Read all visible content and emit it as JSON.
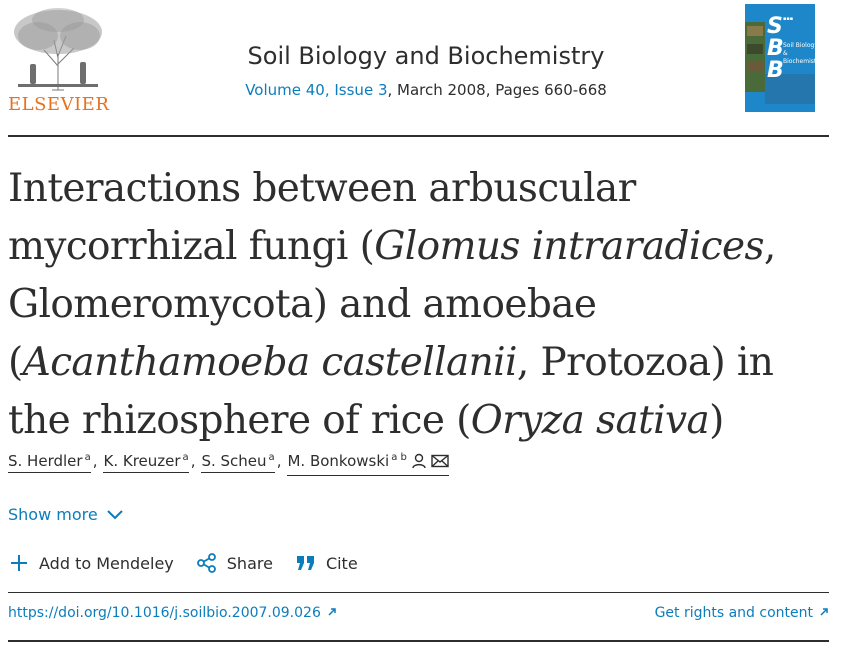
{
  "publisher": {
    "name": "ELSEVIER"
  },
  "journal": {
    "title": "Soil Biology and Biochemistry",
    "volume_issue": "Volume 40, Issue 3",
    "date_pages": ", March 2008, Pages 660-668"
  },
  "cover": {
    "letters": [
      "S",
      "B",
      "B"
    ],
    "title_line1": "Soil Biology &",
    "title_line2": "Biochemistry"
  },
  "article": {
    "title_parts": {
      "p1": "Interactions between arbuscular mycorrhizal fungi (",
      "i1": "Glomus intraradices",
      "p2": ", Glomeromycota) and amoebae (",
      "i2": "Acanthamoeba castellanii",
      "p3": ", Protozoa) in the rhizosphere of rice (",
      "i3": "Oryza sativa",
      "p4": ")"
    }
  },
  "authors": [
    {
      "name": "S. Herdler",
      "aff": "a"
    },
    {
      "name": "K. Kreuzer",
      "aff": "a"
    },
    {
      "name": "S. Scheu",
      "aff": "a"
    },
    {
      "name": "M. Bonkowski",
      "aff": "a b"
    }
  ],
  "show_more": {
    "label": "Show more"
  },
  "actions": {
    "mendeley": "Add to Mendeley",
    "share": "Share",
    "cite": "Cite"
  },
  "links": {
    "doi": "https://doi.org/10.1016/j.soilbio.2007.09.026",
    "rights": "Get rights and content"
  },
  "colors": {
    "link": "#0c7dbb",
    "publisher_orange": "#e9711c",
    "cover_blue": "#1d87c9",
    "text": "#2e2e2e"
  }
}
